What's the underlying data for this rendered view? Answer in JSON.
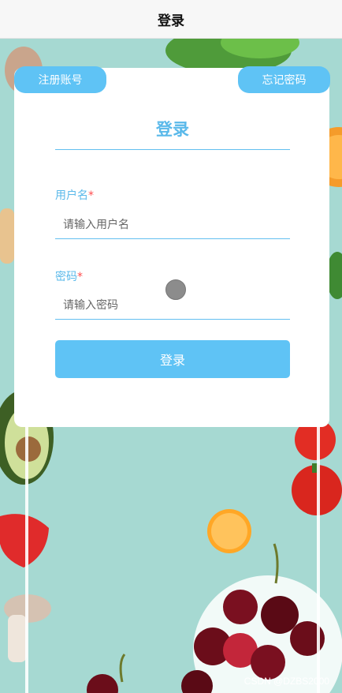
{
  "header": {
    "title": "登录"
  },
  "actions": {
    "register_label": "注册账号",
    "forgot_label": "忘记密码"
  },
  "form": {
    "title": "登录",
    "username": {
      "label": "用户名",
      "required_mark": "*",
      "placeholder": "请输入用户名"
    },
    "password": {
      "label": "密码",
      "required_mark": "*",
      "placeholder": "请输入密码"
    },
    "submit_label": "登录"
  },
  "watermark": "CSDN @DZBS2000",
  "colors": {
    "accent": "#5fc3f5",
    "label": "#5ab9ea",
    "required": "#ff4d4f",
    "background": "#a6d9d2"
  },
  "icons": {
    "cursor": "touch-cursor-icon"
  }
}
